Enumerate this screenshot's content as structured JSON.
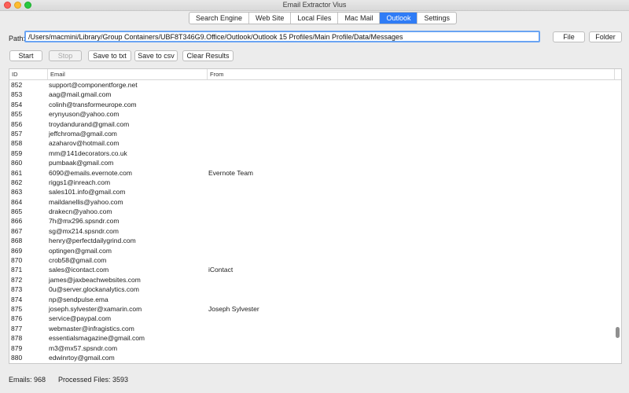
{
  "window": {
    "title": "Email Extractor Vius"
  },
  "tabs": [
    {
      "label": "Search Engine",
      "active": false
    },
    {
      "label": "Web Site",
      "active": false
    },
    {
      "label": "Local Files",
      "active": false
    },
    {
      "label": "Mac Mail",
      "active": false
    },
    {
      "label": "Outlook",
      "active": true
    },
    {
      "label": "Settings",
      "active": false
    }
  ],
  "path": {
    "label": "Path:",
    "value": "/Users/macmini/Library/Group Containers/UBF8T346G9.Office/Outlook/Outlook 15 Profiles/Main Profile/Data/Messages"
  },
  "buttons": {
    "file": "File",
    "folder": "Folder",
    "start": "Start",
    "stop": "Stop",
    "save_txt": "Save to txt",
    "save_csv": "Save to csv",
    "clear": "Clear Results"
  },
  "table": {
    "columns": [
      "ID",
      "Email",
      "From"
    ],
    "rows": [
      {
        "id": "852",
        "email": "support@componentforge.net",
        "from": ""
      },
      {
        "id": "853",
        "email": "aag@mail.gmail.com",
        "from": ""
      },
      {
        "id": "854",
        "email": "colinh@transformeurope.com",
        "from": ""
      },
      {
        "id": "855",
        "email": "erynyuson@yahoo.com",
        "from": ""
      },
      {
        "id": "856",
        "email": "troydandurand@gmail.com",
        "from": ""
      },
      {
        "id": "857",
        "email": "jeffchroma@gmail.com",
        "from": ""
      },
      {
        "id": "858",
        "email": "azaharov@hotmail.com",
        "from": ""
      },
      {
        "id": "859",
        "email": "mm@141decorators.co.uk",
        "from": ""
      },
      {
        "id": "860",
        "email": "pumbaak@gmail.com",
        "from": ""
      },
      {
        "id": "861",
        "email": "6090@emails.evernote.com",
        "from": "Evernote Team"
      },
      {
        "id": "862",
        "email": "riggs1@inreach.com",
        "from": ""
      },
      {
        "id": "863",
        "email": "sales101.info@gmail.com",
        "from": ""
      },
      {
        "id": "864",
        "email": "maildanellis@yahoo.com",
        "from": ""
      },
      {
        "id": "865",
        "email": "drakecn@yahoo.com",
        "from": ""
      },
      {
        "id": "866",
        "email": "7h@mx296.spsndr.com",
        "from": ""
      },
      {
        "id": "867",
        "email": "sg@mx214.spsndr.com",
        "from": ""
      },
      {
        "id": "868",
        "email": "henry@perfectdailygrind.com",
        "from": ""
      },
      {
        "id": "869",
        "email": "optingen@gmail.com",
        "from": ""
      },
      {
        "id": "870",
        "email": "crob58@gmail.com",
        "from": ""
      },
      {
        "id": "871",
        "email": "sales@icontact.com",
        "from": "iContact"
      },
      {
        "id": "872",
        "email": "james@jaxbeachwebsites.com",
        "from": ""
      },
      {
        "id": "873",
        "email": "0u@server.glockanalytics.com",
        "from": ""
      },
      {
        "id": "874",
        "email": "np@sendpulse.ema",
        "from": ""
      },
      {
        "id": "875",
        "email": "joseph.sylvester@xamarin.com",
        "from": "Joseph Sylvester"
      },
      {
        "id": "876",
        "email": "service@paypal.com",
        "from": ""
      },
      {
        "id": "877",
        "email": "webmaster@infragistics.com",
        "from": ""
      },
      {
        "id": "878",
        "email": "essentialsmagazine@gmail.com",
        "from": ""
      },
      {
        "id": "879",
        "email": "m3@mx57.spsndr.com",
        "from": ""
      },
      {
        "id": "880",
        "email": "edwinrtoy@gmail.com",
        "from": ""
      }
    ]
  },
  "status": {
    "emails": "Emails: 968",
    "files": "Processed Files: 3593"
  },
  "colors": {
    "accent": "#2f7cf6",
    "focus_ring": "#6aa4f3"
  },
  "icons": [
    "close-icon",
    "minimize-icon",
    "zoom-icon"
  ]
}
